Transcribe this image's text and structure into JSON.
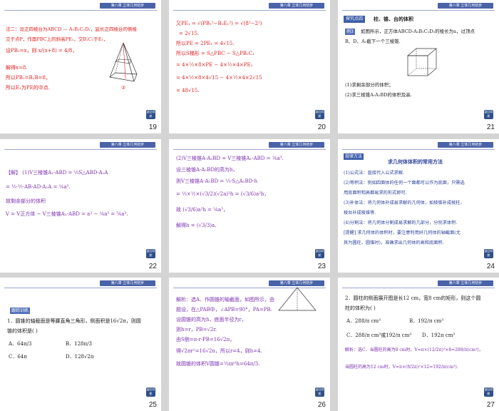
{
  "header": "第八章 立体几何初步",
  "btn": "返回导航",
  "s19": {
    "num": "19",
    "l1": "法二：设正四棱台为ABCD — A₁B₁C₁D₁，延长正四棱台的侧棱",
    "l2": "交于点P，作面PBC上的斜高PE₁，交B₁C₁于E₁，",
    "l3": "设PB₁=x，则 x/(x+8) = 4/8，",
    "l4": "解得x=8.",
    "l5": "所以PB₁=B₁B=8，",
    "l6": "所以E₁为PE的中点.",
    "mark": "②"
  },
  "s20": {
    "num": "20",
    "l1": "又PE₁ = √(PB₁²−B₁E₁²) = √(8²−2²)",
    "l2": "= 2√15.",
    "l3": "所以PE = 2PE₁ = 4√15.",
    "l4": "所以S梯形 = S△PBC − S△PB₁C₁",
    "l5": "= 4×½×8×PE − 4×½×4×PE₁",
    "l6": "= 4×½×8×4√15 − 4×½×4×2√15",
    "l7": "= 48√15."
  },
  "s21": {
    "num": "21",
    "tag": "探究点四",
    "title": "柱、锥、台的体积",
    "ex": "例3",
    "l1": "如图所示，正方体ABCD-A₁B₁C₁D₁的棱长为a，过顶点",
    "l2": "B、D、A₁截下一个三棱锥.",
    "l3": "(1)求剩余部分的体积；",
    "l4": "(2)求三棱锥A-A₁BD的体积及高."
  },
  "s22": {
    "num": "22",
    "l1": "【解】 (1)V三棱锥A₁-ABD = ⅓S△ABD·A₁A",
    "l2": "= ⅓·½·AB·AD·A₁A = ⅙a³.",
    "l3": "故剩余部分的体积",
    "l4": "V = V正方体 − V三棱锥A₁-ABD = a³ − ⅙a³ = ⅚a³."
  },
  "s23": {
    "num": "23",
    "l1": "(2)V三棱锥A-A₁BD = V三棱锥A₁-ABD = ⅙a³.",
    "l2": "设三棱锥A-A₁BD的高为h，",
    "l3": "则V三棱锥A-A₁BD = ⅓·S△A₁BD·h",
    "l4": "= ⅓×½×(√3/2)(√2a)²h = (√3/6)a²h，",
    "l5": "故 (√3/6)a²h = ⅙a³，",
    "l6": "解得h = (√3/3)a."
  },
  "s24": {
    "num": "24",
    "tag": "规律方法",
    "title": "求几何体体积的常用方法",
    "l1": "(1)公式法：直接代入公式求解.",
    "l2": "(2)等积法：例如四面体的任何一个面都可以作为底面，只需选",
    "l3": "用底面积和高都易求的形式即可.",
    "l4": "(3)补体法：将几何体补成易求解的几何体，如棱锥补成棱柱，",
    "l5": "棱台补成棱锥等.",
    "l6": "(4)分割法：将几何体分割成易求解的几部分，分别求体积.",
    "l7": "[提醒] 求几何体的体积时，要注意利用好几何体的轴截面(尤",
    "l8": "其为圆柱、圆锥时)，准确求出几何体的高和底面积."
  },
  "s25": {
    "num": "25",
    "tag": "跟踪训练",
    "l1": "1．圆锥的轴截面是等腰直角三角形，侧面积是16√2π，则圆",
    "l2": "锥的体积是(      )",
    "oA": "A．64π/3",
    "oB": "B．128π/3",
    "oC": "C．64π",
    "oD": "D．128√2π"
  },
  "s26": {
    "num": "26",
    "l1": "解析：选A．作圆锥的轴截面，如图所示，由",
    "l2": "题设，在△PAB中，∠APB=90°，PA=PB.",
    "l3": "设圆锥的高为h，底面半径为r，",
    "l4": "则h=r，PB=√2r.",
    "l5": "由S侧=π·r·PB=16√2π，",
    "l6": "得√2πr²=16√2π，所以r=4，则h=4.",
    "l7": "故圆锥的体积V圆锥=⅓πr²h=64π/3."
  },
  "s27": {
    "num": "27",
    "l1": "2．圆柱的侧面展开图是长12 cm，宽8 cm的矩形，则这个圆",
    "l2": "柱的体积为(      )",
    "oA": "A．288/π cm³",
    "oB": "B．192/π cm³",
    "oC": "C．288/π cm³或192/π cm³",
    "oD": "D．192π cm³",
    "l3": "解析：选C．当圆柱的高为8 cm时，V=π×(12/2π)²×8=288/π(cm³)，",
    "l4": "当圆柱的高为12 cm时，V=π×(8/2π)²×12=192/π(cm³)."
  }
}
